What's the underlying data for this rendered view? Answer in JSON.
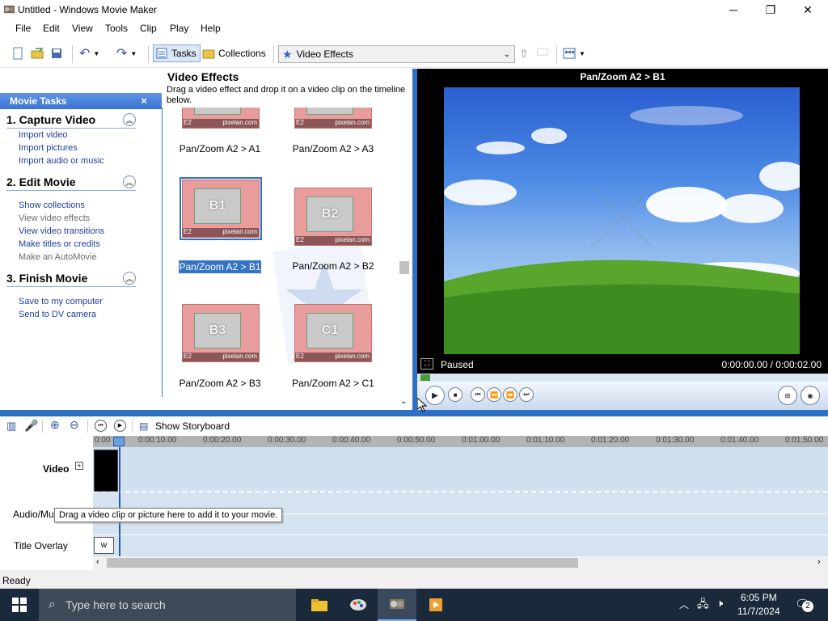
{
  "window": {
    "title": "Untitled - Windows Movie Maker",
    "minimize": "─",
    "maximize": "❐",
    "close": "✕"
  },
  "menu": [
    "File",
    "Edit",
    "View",
    "Tools",
    "Clip",
    "Play",
    "Help"
  ],
  "toolbar": {
    "tasks_label": "Tasks",
    "collections_label": "Collections",
    "collection_selected": "Video Effects"
  },
  "tasks": {
    "header": "Movie Tasks",
    "close": "×",
    "sections": [
      {
        "title": "1. Capture Video",
        "links": [
          {
            "label": "Import video",
            "enabled": true
          },
          {
            "label": "Import pictures",
            "enabled": true
          },
          {
            "label": "Import audio or music",
            "enabled": true
          }
        ]
      },
      {
        "title": "2. Edit Movie",
        "links": [
          {
            "label": "Show collections",
            "enabled": true
          },
          {
            "label": "View video effects",
            "enabled": false
          },
          {
            "label": "View video transitions",
            "enabled": true
          },
          {
            "label": "Make titles or credits",
            "enabled": true
          },
          {
            "label": "Make an AutoMovie",
            "enabled": false
          }
        ]
      },
      {
        "title": "3. Finish Movie",
        "links": [
          {
            "label": "Save to my computer",
            "enabled": true
          },
          {
            "label": "Send to DV camera",
            "enabled": true
          }
        ]
      }
    ]
  },
  "effects": {
    "title": "Video Effects",
    "description": "Drag a video effect and drop it on a video clip on the timeline below.",
    "items": [
      {
        "label": "Pan/Zoom A2 > A1",
        "thumb_text": "",
        "code": "E2",
        "site": "pixelan.com"
      },
      {
        "label": "Pan/Zoom A2 > A3",
        "thumb_text": "",
        "code": "E2",
        "site": "pixelan.com"
      },
      {
        "label": "Pan/Zoom A2 > B1",
        "thumb_text": "B1",
        "code": "E2",
        "site": "pixelan.com",
        "selected": true
      },
      {
        "label": "Pan/Zoom A2 > B2",
        "thumb_text": "B2",
        "code": "E2",
        "site": "pixelan.com"
      },
      {
        "label": "Pan/Zoom A2 > B3",
        "thumb_text": "B3",
        "code": "E2",
        "site": "pixelan.com"
      },
      {
        "label": "Pan/Zoom A2 > C1",
        "thumb_text": "C1",
        "code": "E2",
        "site": "pixelan.com"
      }
    ]
  },
  "preview": {
    "title": "Pan/Zoom A2 > B1",
    "status": "Paused",
    "time": "0:00:00.00 / 0:00:02.00"
  },
  "timeline": {
    "show_storyboard": "Show Storyboard",
    "ruler": [
      "0:00",
      "0:00:10.00",
      "0:00:20.00",
      "0:00:30.00",
      "0:00:40.00",
      "0:00:50.00",
      "0:01:00.00",
      "0:01:10.00",
      "0:01:20.00",
      "0:01:30.00",
      "0:01:40.00",
      "0:01:50.00"
    ],
    "tracks": {
      "video": "Video",
      "audio": "Audio/Mu",
      "title_overlay": "Title Overlay"
    },
    "tooltip": "Drag a video clip or picture here to add it to your movie.",
    "overlay_marker": "w"
  },
  "status": "Ready",
  "taskbar": {
    "search_placeholder": "Type here to search",
    "time": "6:05 PM",
    "date": "11/7/2024",
    "notifications": "2"
  }
}
